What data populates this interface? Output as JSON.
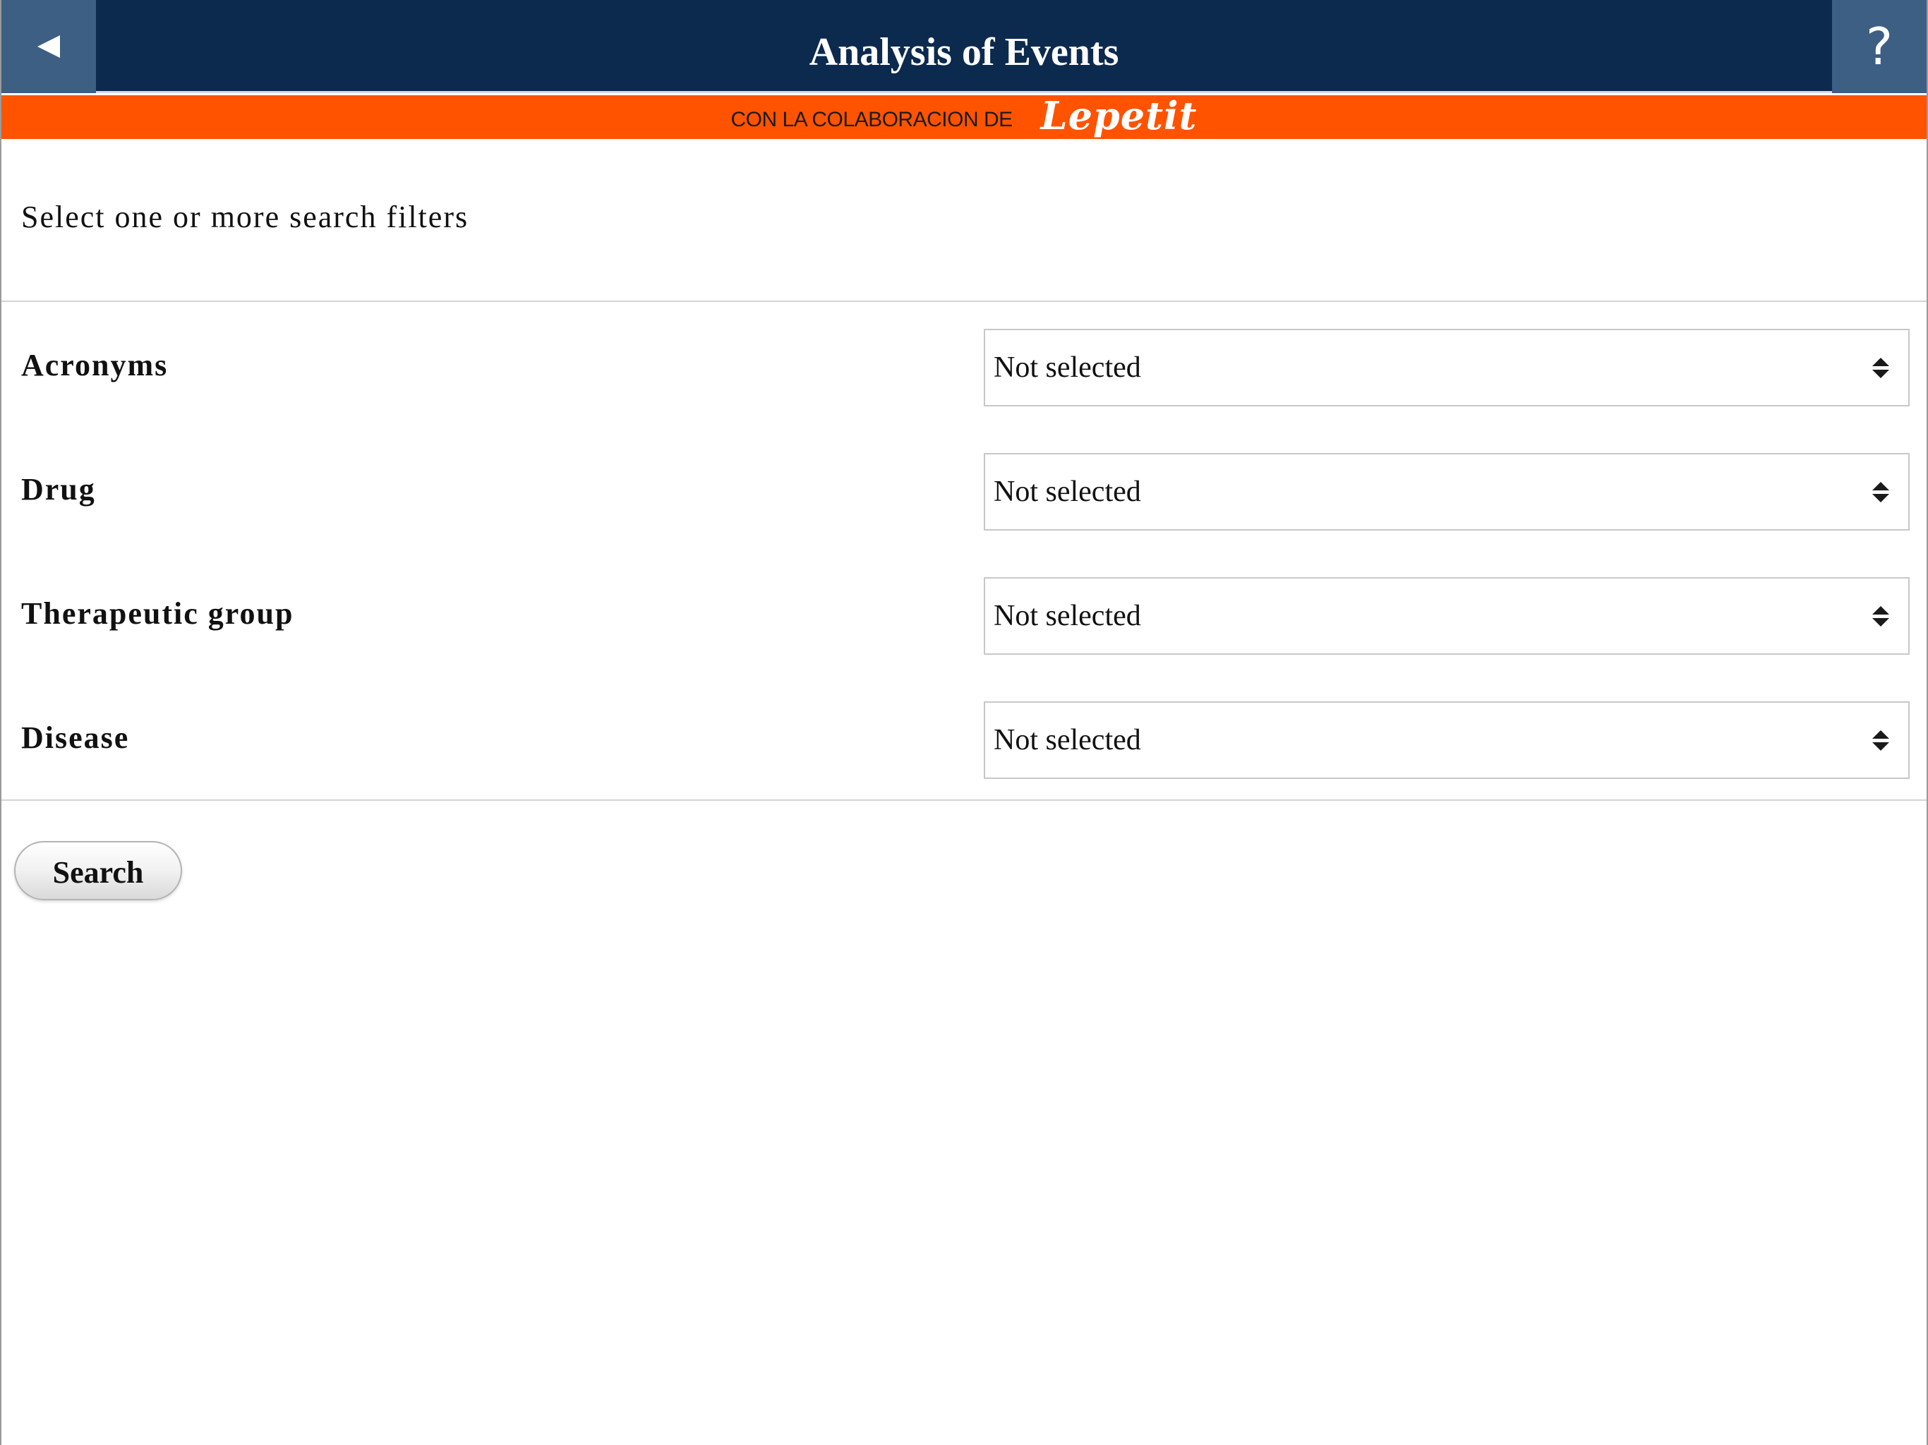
{
  "header": {
    "title": "Analysis of Events",
    "back_icon": "back-triangle-icon",
    "help_label": "?"
  },
  "sponsor": {
    "text": "CON LA COLABORACION DE",
    "logo": "Lepetit"
  },
  "instructions": "Select one or more search filters",
  "filters": [
    {
      "label": "Acronyms",
      "value": "Not selected"
    },
    {
      "label": "Drug",
      "value": "Not selected"
    },
    {
      "label": "Therapeutic group",
      "value": "Not selected"
    },
    {
      "label": "Disease",
      "value": "Not selected"
    }
  ],
  "search_button": "Search",
  "colors": {
    "header_bg": "#0c2a4e",
    "header_button_bg": "#3d5f84",
    "sponsor_bg": "#ff5300"
  }
}
